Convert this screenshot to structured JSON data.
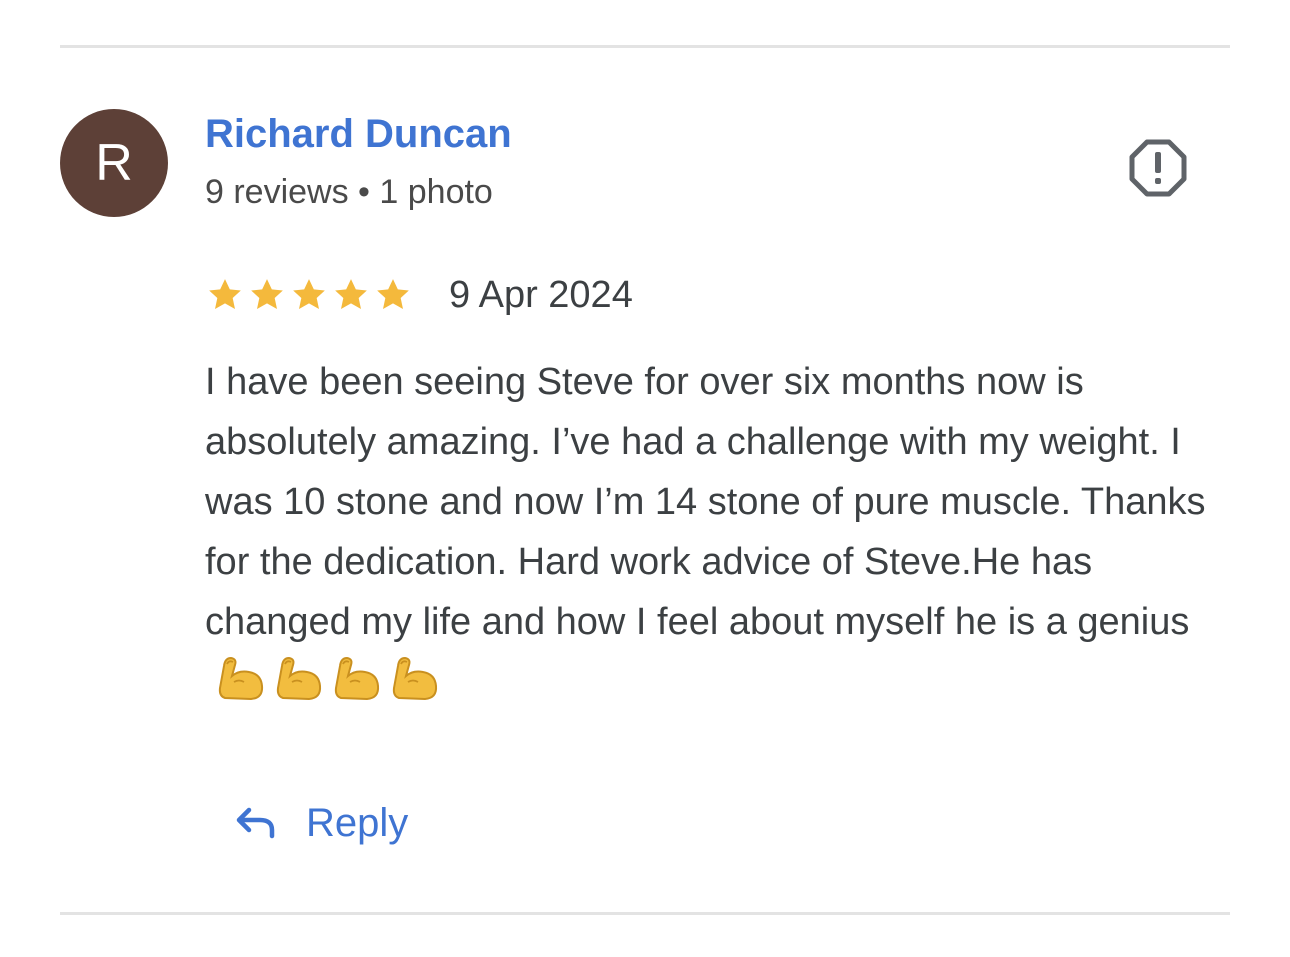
{
  "review": {
    "avatar_letter": "R",
    "avatar_color": "#5d4037",
    "author_name": "Richard Duncan",
    "author_meta": "9 reviews • 1 photo",
    "rating": 5,
    "rating_max": 5,
    "date": "9 Apr 2024",
    "text": "I have been seeing Steve for over six months now is absolutely amazing. I’ve had a challenge with my weight. I was 10 stone and now I’m 14 stone of pure muscle. Thanks for the dedication. Hard work advice of Steve.He has changed my life and how I feel about myself he is a genius",
    "emoji_count": 4,
    "emoji_name": "flexed-biceps-icon"
  },
  "actions": {
    "report_icon": "report-icon",
    "reply_icon": "reply-arrow-icon",
    "reply_label": "Reply"
  },
  "colors": {
    "link_blue": "#3f74d2",
    "star_gold": "#f4b93c",
    "divider": "#e3e3e3",
    "text": "#3c4043"
  }
}
